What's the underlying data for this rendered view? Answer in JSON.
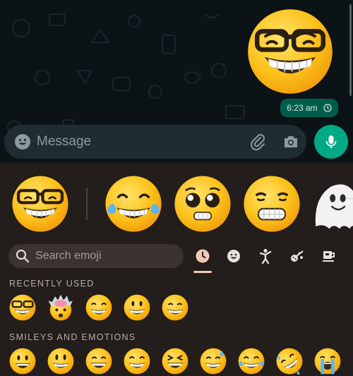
{
  "chat": {
    "message_time": "6:23 am"
  },
  "composer": {
    "placeholder": "Message"
  },
  "keyboard": {
    "search_placeholder": "Search emoji",
    "categories": [
      "recent-clock-icon",
      "smiley-icon",
      "people-icon",
      "activity-icon",
      "food-cup-icon"
    ],
    "recently_used_label": "RECENTLY USED",
    "smileys_label": "SMILEYS AND EMOTIONS"
  },
  "colors": {
    "accent_green": "#00a884",
    "bubble_green": "#005c4b",
    "panel_bg": "#231d1b"
  }
}
